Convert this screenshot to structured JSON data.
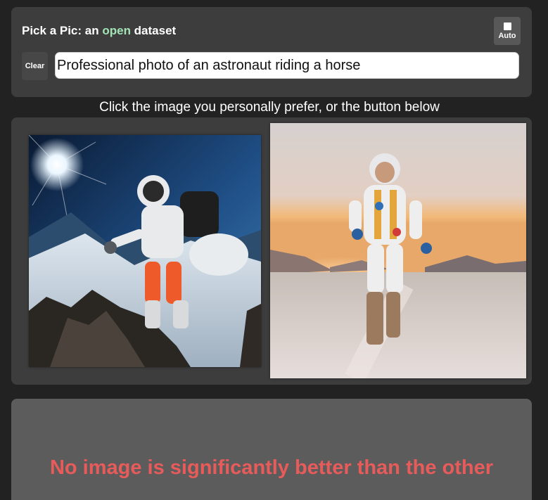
{
  "header": {
    "title_prefix": "Pick a Pic: an ",
    "title_accent": "open",
    "title_suffix": " dataset",
    "auto_label": "Auto",
    "clear_label": "Clear",
    "prompt_value": "Professional photo of an astronaut riding a horse"
  },
  "instruction": "Click the image you personally prefer, or the button below",
  "tie_button": {
    "label": "No image is significantly better than the other"
  },
  "colors": {
    "background": "#222222",
    "card": "#3d3d3d",
    "accent": "#a3e3b5",
    "tie_text": "#e85b5b"
  }
}
